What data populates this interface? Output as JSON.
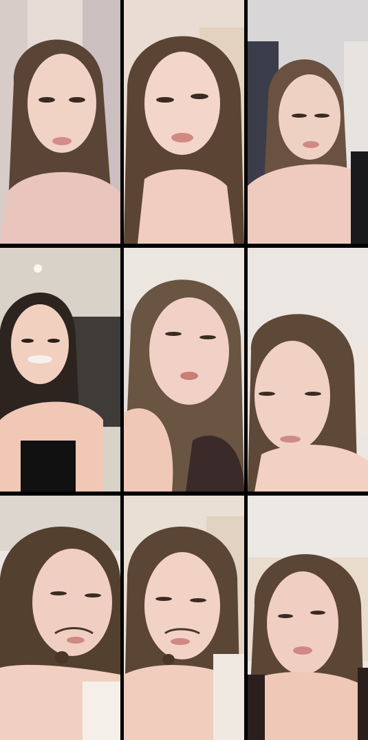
{
  "grid": {
    "columns": 3,
    "rows": 3,
    "tiles": [
      {
        "id": 1,
        "bg": "#e7dbd6",
        "wall": "#d8ccc8",
        "hair": "#5a4436",
        "skin": "#f1d3c6",
        "top": "#e9c5bd"
      },
      {
        "id": 2,
        "bg": "#e9ddd3",
        "wall": "#e3d2bf",
        "hair": "#5b4433",
        "skin": "#f3d6c9",
        "top": "#f0cdbf"
      },
      {
        "id": 3,
        "bg": "#d9d6d8",
        "wall": "#3c3d4a",
        "hair": "#6a5140",
        "skin": "#efd1c4",
        "top": "#1a1a1c"
      },
      {
        "id": 4,
        "bg": "#d9d2c8",
        "wall": "#3e3b39",
        "hair": "#2d2420",
        "skin": "#f2d0bf",
        "top": "#111111"
      },
      {
        "id": 5,
        "bg": "#e5ded9",
        "wall": "#ece6e1",
        "hair": "#6a5442",
        "skin": "#f1d1c5",
        "top": "#3a2a2a"
      },
      {
        "id": 6,
        "bg": "#ece6e2",
        "wall": "#efe7df",
        "hair": "#5e4838",
        "skin": "#f0d1c4",
        "top": "#f2d0c2"
      },
      {
        "id": 7,
        "bg": "#ebe6e3",
        "wall": "#dcd6cf",
        "hair": "#54402f",
        "skin": "#f0cfc2",
        "top": "#f2d0c1"
      },
      {
        "id": 8,
        "bg": "#eadfd4",
        "wall": "#e1d2c1",
        "hair": "#5b4534",
        "skin": "#f1d2c4",
        "top": "#efe9e1"
      },
      {
        "id": 9,
        "bg": "#ece8e3",
        "wall": "#e9dccd",
        "hair": "#5b4535",
        "skin": "#f0cfc2",
        "top": "#2a1f1c"
      }
    ]
  }
}
